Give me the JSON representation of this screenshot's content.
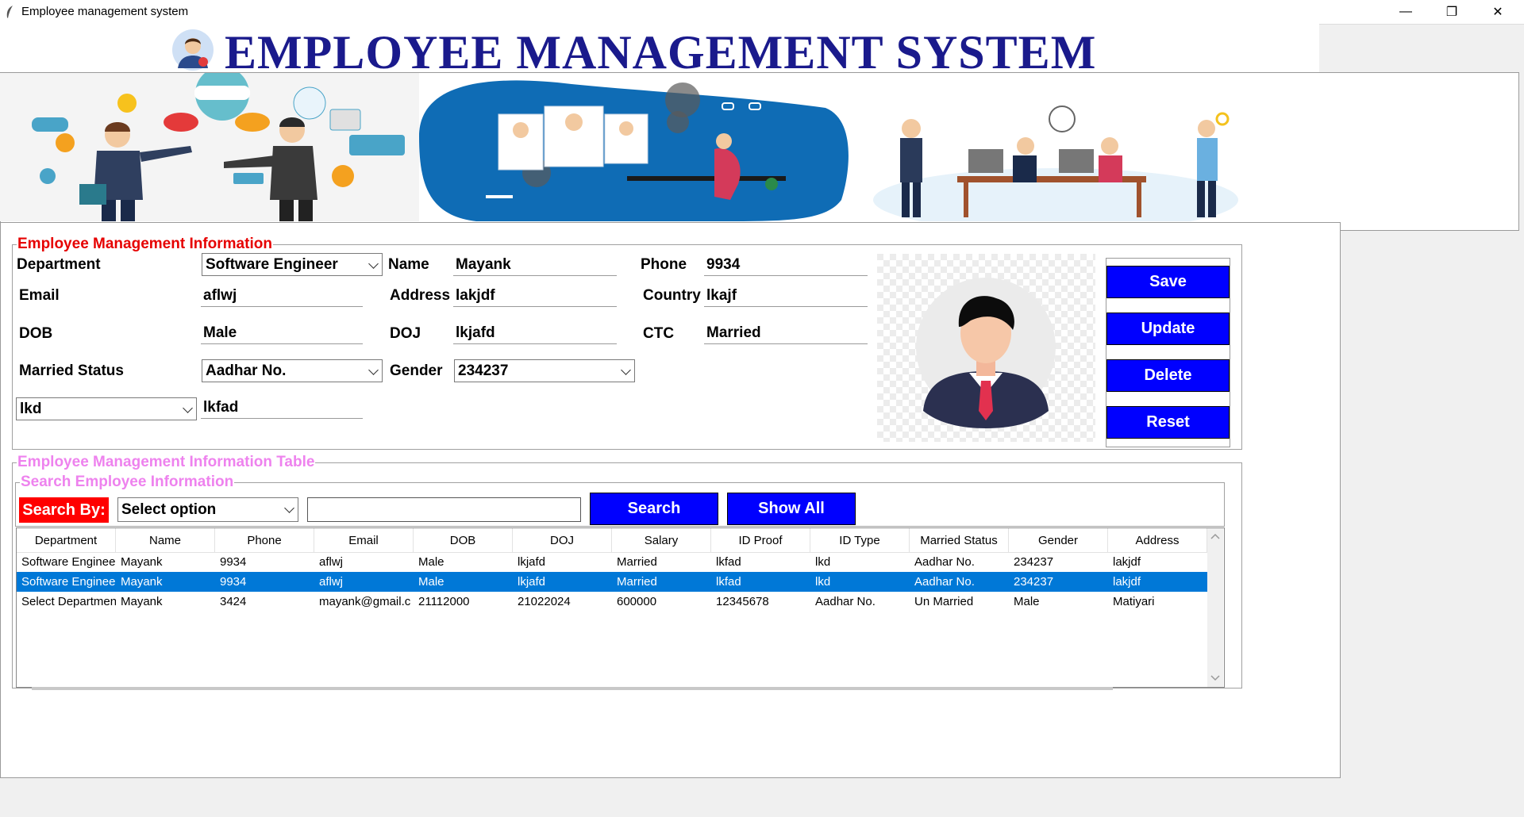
{
  "window": {
    "title": "Employee management system",
    "minimize": "—",
    "maximize": "❐",
    "close": "✕"
  },
  "header": {
    "title": "EMPLOYEE MANAGEMENT SYSTEM"
  },
  "form": {
    "legend": "Employee Management Information",
    "legend_color": "#e60000",
    "labels": {
      "department": "Department",
      "name": "Name",
      "phone": "Phone",
      "email": "Email",
      "address": "Address",
      "country": "Country",
      "dob": "DOB",
      "doj": "DOJ",
      "ctc": "CTC",
      "married_status": "Married Status",
      "gender": "Gender"
    },
    "values": {
      "department": "Software Engineer",
      "name": "Mayank",
      "phone": "9934",
      "email": "aflwj",
      "address": "lakjdf",
      "country": "lkajf",
      "dob": "Male",
      "doj": "lkjafd",
      "ctc": "Married",
      "married_status": "Aadhar No.",
      "gender": "234237",
      "id_type": "lkd",
      "id_proof": "lkfad"
    }
  },
  "buttons": {
    "save": "Save",
    "update": "Update",
    "delete": "Delete",
    "reset": "Reset",
    "color": "#0000ff"
  },
  "table_section": {
    "legend": "Employee Management Information Table",
    "search_legend": "Search Employee Information",
    "legend_color": "#ee82ee",
    "search_by_label": "Search By:",
    "search_by_bg": "#ff0000",
    "search_option": "Select option",
    "search_value": "",
    "search_button": "Search",
    "show_all_button": "Show All"
  },
  "table": {
    "columns": [
      "Department",
      "Name",
      "Phone",
      "Email",
      "DOB",
      "DOJ",
      "Salary",
      "ID Proof",
      "ID Type",
      "Married Status",
      "Gender",
      "Address"
    ],
    "rows": [
      [
        "Software Enginee",
        "Mayank",
        "9934",
        "aflwj",
        "Male",
        "lkjafd",
        "Married",
        "lkfad",
        "lkd",
        "Aadhar No.",
        "234237",
        "lakjdf"
      ],
      [
        "Software Enginee",
        "Mayank",
        "9934",
        "aflwj",
        "Male",
        "lkjafd",
        "Married",
        "lkfad",
        "lkd",
        "Aadhar No.",
        "234237",
        "lakjdf"
      ],
      [
        "Select Departmen",
        "Mayank",
        "3424",
        "mayank@gmail.c",
        "21112000",
        "21022024",
        "600000",
        "12345678",
        "Aadhar No.",
        "Un Married",
        "Male",
        "Matiyari"
      ]
    ],
    "selected_row": 1
  }
}
